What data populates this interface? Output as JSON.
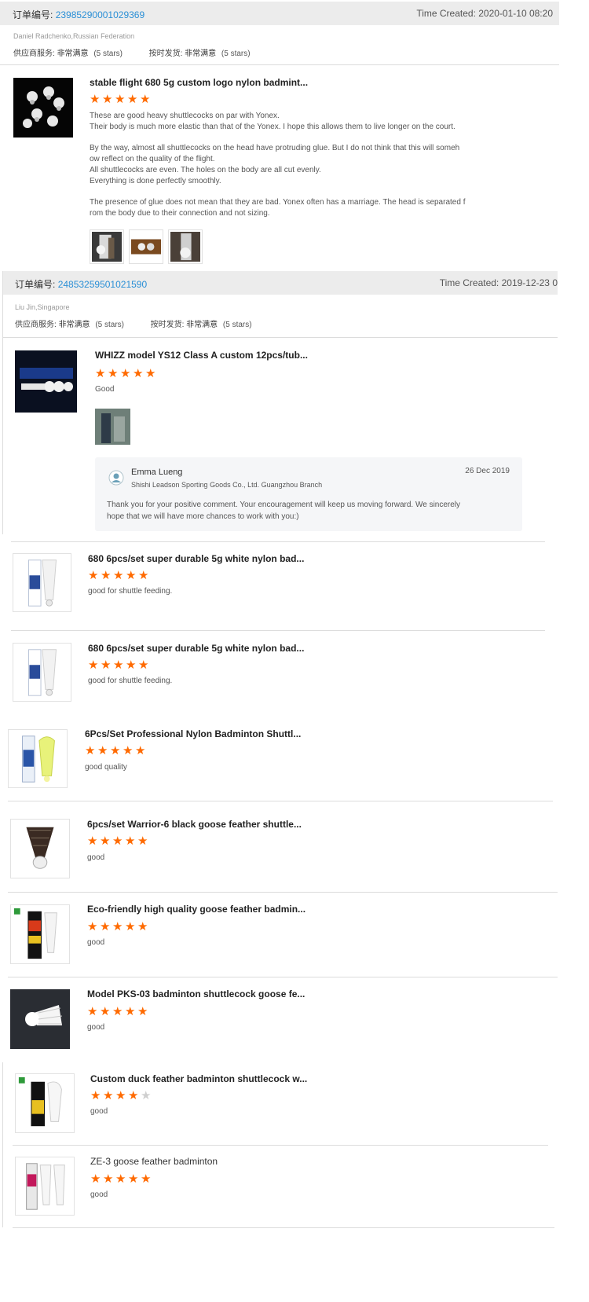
{
  "order1": {
    "label": "订单编号:",
    "number": "23985290001029369",
    "time": "Time Created: 2020-01-10 08:20",
    "buyer": "Daniel Radchenko,Russian Federation",
    "service_label": "供应商服务:",
    "service_value": "非常满意",
    "service_stars": "(5 stars)",
    "shipping_label": "按时发货:",
    "shipping_value": "非常满意",
    "shipping_stars": "(5 stars)",
    "item": {
      "title": "stable flight 680 5g custom logo nylon badmint...",
      "rating": 5,
      "review_lines": [
        "These are good heavy shuttlecocks on par with Yonex.",
        "Their body is much more elastic than that of the Yonex. I hope this allows them to live longer on the court.",
        "",
        "By the way, almost all shuttlecocks on the head have protruding glue. But I do not think that this will someh",
        "ow reflect on the quality of the flight.",
        "All shuttlecocks are even. The holes on the body are all cut evenly.",
        "Everything is done perfectly smoothly.",
        "",
        "The presence of glue does not mean that they are bad. Yonex often has a marriage. The head is separated f",
        "rom the body due to their connection and not sizing."
      ]
    }
  },
  "order2": {
    "label": "订单编号:",
    "number": "24853259501021590",
    "time": "Time Created: 2019-12-23 0",
    "buyer": "Liu Jin,Singapore",
    "service_label": "供应商服务:",
    "service_value": "非常满意",
    "service_stars": "(5 stars)",
    "shipping_label": "按时发货:",
    "shipping_value": "非常满意",
    "shipping_stars": "(5 stars)",
    "item": {
      "title": "WHIZZ model YS12 Class A custom 12pcs/tub...",
      "rating": 5,
      "review": "Good"
    },
    "reply": {
      "name": "Emma Lueng",
      "company": "Shishi Leadson Sporting Goods Co., Ltd. Guangzhou Branch",
      "date": "26 Dec 2019",
      "message_lines": [
        "Thank you for your positive comment. Your encouragement will keep us moving forward. We sincerely",
        "hope that we will have more chances to work with you:)"
      ]
    }
  },
  "reviews": [
    {
      "title": "680 6pcs/set super durable 5g white nylon bad...",
      "rating": 5,
      "text": "good for shuttle feeding."
    },
    {
      "title": "680 6pcs/set super durable 5g white nylon bad...",
      "rating": 5,
      "text": "good for shuttle feeding."
    },
    {
      "title": "6Pcs/Set Professional Nylon Badminton Shuttl...",
      "rating": 5,
      "text": "good quality"
    },
    {
      "title": "6pcs/set Warrior-6 black goose feather shuttle...",
      "rating": 5,
      "text": "good"
    },
    {
      "title": "Eco-friendly high quality goose feather badmin...",
      "rating": 5,
      "text": "good"
    },
    {
      "title": "Model PKS-03 badminton shuttlecock goose fe...",
      "rating": 5,
      "text": "good"
    },
    {
      "title": "Custom duck feather badminton shuttlecock w...",
      "rating": 4,
      "text": "good"
    },
    {
      "title": "ZE-3 goose feather badminton",
      "rating": 5,
      "text": "good"
    }
  ],
  "colors": {
    "star_on": "#ff6a00",
    "star_off": "#cfcfcf",
    "order_link": "#2a8fd6",
    "header_bg": "#ececec"
  },
  "icons": {
    "star": "star-icon",
    "avatar": "supplier-avatar-icon"
  }
}
